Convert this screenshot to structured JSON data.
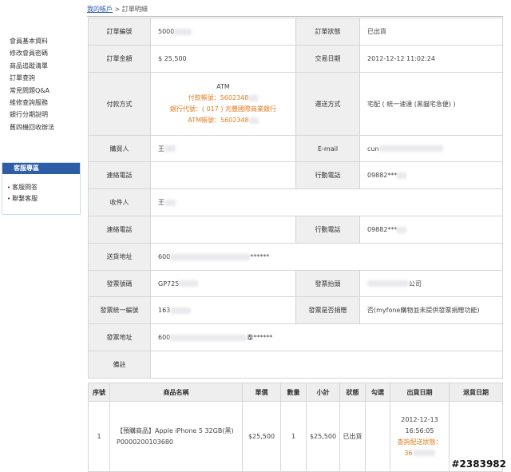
{
  "breadcrumb": {
    "link": "我的帳戶",
    "separator": ">",
    "current": "訂單明細"
  },
  "sidebar": {
    "menu": [
      "會員基本資料",
      "修改會員密碼",
      "商品追蹤清單",
      "訂單查詢",
      "常見問題Q&A",
      "維修查詢服務",
      "銀行分期說明",
      "舊四機回收辦法"
    ],
    "service_title": "客服專區",
    "service_links": [
      "客服問答",
      "聯繫客服"
    ]
  },
  "order": {
    "order_no_label": "訂單編號",
    "order_no": "5000",
    "status_label": "訂單狀態",
    "status": "已出貨",
    "amount_label": "訂單金額",
    "amount": "$ 25,500",
    "date_label": "交易日期",
    "date": "2012-12-12 11:02:24",
    "payment_label": "付款方式",
    "payment_method": "ATM",
    "payment_account": "付款帳號：5602348",
    "bank_code": "銀行代號：( 017 ) 兆豐國際商業銀行",
    "atm_account": "ATM帳號：5602348",
    "delivery_label": "運送方式",
    "delivery": "宅配 ( 統一速達 (黑貓宅急便) )",
    "buyer_label": "購買人",
    "buyer": "王",
    "email_label": "E-mail",
    "email": "cun",
    "phone_label": "連絡電話",
    "phone": "",
    "mobile_label": "行動電話",
    "mobile": "09882***",
    "receiver_label": "收件人",
    "receiver": "王",
    "receiver_phone_label": "連絡電話",
    "receiver_phone": "",
    "receiver_mobile_label": "行動電話",
    "receiver_mobile": "09882***",
    "ship_address_label": "送貨地址",
    "ship_address": "600",
    "ship_address_tail": "******",
    "invoice_no_label": "發票號碼",
    "invoice_no": "GP725",
    "invoice_title_label": "發票抬頭",
    "invoice_title": "公司",
    "tax_id_label": "發票統一編號",
    "tax_id": "163",
    "donate_label": "發票是否捐贈",
    "donate": "否(myfone購物並未提供發票捐贈功能)",
    "invoice_address_label": "發票地址",
    "invoice_address": "600",
    "invoice_address_tail": "泰******",
    "note_label": "備註",
    "note": ""
  },
  "items": {
    "headers": [
      "序號",
      "商品名稱",
      "單價",
      "數量",
      "小計",
      "狀態",
      "勾選",
      "出貨日期",
      "退貨日期"
    ],
    "rows": [
      {
        "index": "1",
        "name": "【預購商品】Apple iPhone 5 32GB(黑)",
        "code": "P0000200103680",
        "price": "$25,500",
        "qty": "1",
        "subtotal": "$25,500",
        "status": "已出貨",
        "ship_date": "2012-12-13",
        "ship_time": "16:56:05",
        "ship_query_label": "查詢配送狀態：",
        "ship_query_no": "36"
      }
    ]
  },
  "watermark": "#2383982"
}
